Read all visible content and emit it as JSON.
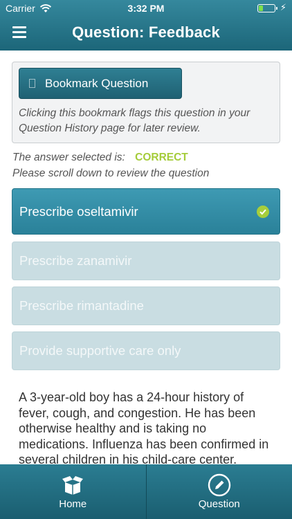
{
  "status_bar": {
    "carrier": "Carrier",
    "time": "3:32 PM",
    "battery_level": 0.25,
    "battery_color": "#7ee04b"
  },
  "nav": {
    "title": "Question: Feedback",
    "menu_icon": "hamburger-menu-icon"
  },
  "bookmark": {
    "button_label": "Bookmark Question",
    "note": "Clicking this bookmark flags this question in your Question History page for later review."
  },
  "result": {
    "label": "The answer selected is:",
    "status": "CORRECT",
    "status_color": "#a5cc3a",
    "scroll_note": "Please scroll down to review the question"
  },
  "options": [
    {
      "label": "Prescribe oseltamivir",
      "selected": true
    },
    {
      "label": "Prescribe zanamivir",
      "selected": false
    },
    {
      "label": "Prescribe rimantadine",
      "selected": false
    },
    {
      "label": "Provide supportive care only",
      "selected": false
    }
  ],
  "question": {
    "text": "A 3-year-old boy has a 24-hour history of fever, cough, and congestion. He has been otherwise healthy and is taking no medications. Influenza has been confirmed in several children in his child-care center."
  },
  "tabs": [
    {
      "label": "Home",
      "icon": "open-box-icon"
    },
    {
      "label": "Question",
      "icon": "pencil-circle-icon"
    }
  ],
  "colors": {
    "header_top": "#35889d",
    "header_bottom": "#1c6679",
    "selected_option": "#3e9ab3",
    "unselected_option": "#c9dde2"
  }
}
